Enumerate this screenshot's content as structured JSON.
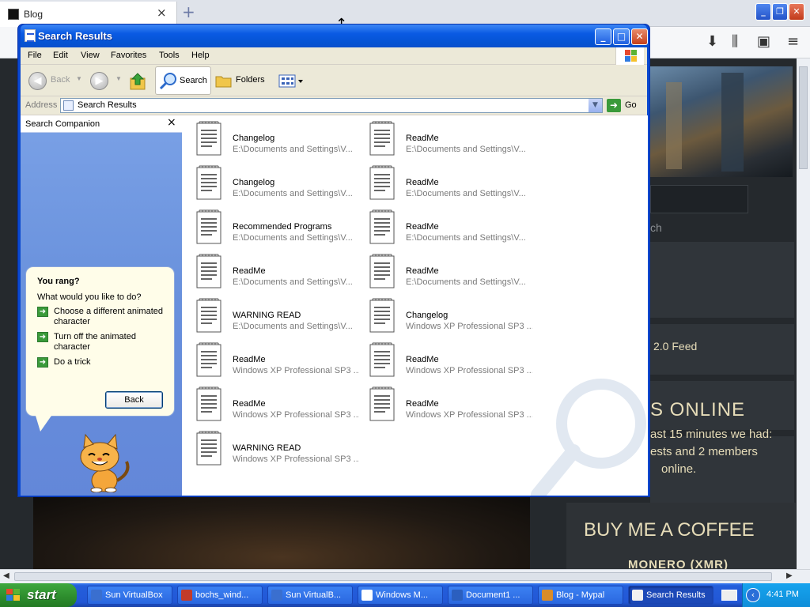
{
  "browser": {
    "tab_title": "Blog",
    "tab_close": "×",
    "new_tab": "+",
    "site": {
      "search_partial": "ch",
      "feed_text": "2.0 Feed",
      "online_title": "S ONLINE",
      "online_line1": "ast 15 minutes we had:",
      "online_line2": "ests and 2 members",
      "online_line3": "online.",
      "coffee_title": "BUY ME A COFFEE",
      "coffee_sub": "MONERO (XMR)"
    }
  },
  "window": {
    "title": "Search Results",
    "menu": [
      "File",
      "Edit",
      "View",
      "Favorites",
      "Tools",
      "Help"
    ],
    "toolbar": {
      "back_label": "Back",
      "search_label": "Search",
      "folders_label": "Folders"
    },
    "address": {
      "label": "Address",
      "value": "Search Results",
      "go_label": "Go"
    },
    "companion": {
      "title": "Search Companion",
      "close": "×",
      "question": "You rang?",
      "prompt": "What would you like to do?",
      "options": [
        "Choose a different animated character",
        "Turn off the animated character",
        "Do a trick"
      ],
      "back_button": "Back"
    },
    "results": [
      {
        "name": "Changelog",
        "path": "E:\\Documents and Settings\\V..."
      },
      {
        "name": "ReadMe",
        "path": "E:\\Documents and Settings\\V..."
      },
      {
        "name": "Changelog",
        "path": "E:\\Documents and Settings\\V..."
      },
      {
        "name": "ReadMe",
        "path": "E:\\Documents and Settings\\V..."
      },
      {
        "name": "Recommended Programs",
        "path": "E:\\Documents and Settings\\V..."
      },
      {
        "name": "ReadMe",
        "path": "E:\\Documents and Settings\\V..."
      },
      {
        "name": "ReadMe",
        "path": "E:\\Documents and Settings\\V..."
      },
      {
        "name": "ReadMe",
        "path": "E:\\Documents and Settings\\V..."
      },
      {
        "name": "WARNING READ",
        "path": "E:\\Documents and Settings\\V..."
      },
      {
        "name": "Changelog",
        "path": "Windows XP Professional SP3 ..."
      },
      {
        "name": "ReadMe",
        "path": "Windows XP Professional SP3 ..."
      },
      {
        "name": "ReadMe",
        "path": "Windows XP Professional SP3 ..."
      },
      {
        "name": "ReadMe",
        "path": "Windows XP Professional SP3 ..."
      },
      {
        "name": "ReadMe",
        "path": "Windows XP Professional SP3 ..."
      },
      {
        "name": "WARNING READ",
        "path": "Windows XP Professional SP3 ..."
      }
    ]
  },
  "taskbar": {
    "start_label": "start",
    "tasks": [
      {
        "label": "Sun VirtualBox",
        "icon_color": "#3a6fcf"
      },
      {
        "label": "bochs_wind...",
        "icon_color": "#c23b2a"
      },
      {
        "label": "Sun VirtualB...",
        "icon_color": "#3a6fcf"
      },
      {
        "label": "Windows M...",
        "icon_color": "#ffffff"
      },
      {
        "label": "Document1 ...",
        "icon_color": "#2b5fbf"
      },
      {
        "label": "Blog - Mypal",
        "icon_color": "#d98c2a"
      },
      {
        "label": "Search Results",
        "icon_color": "#f1f1f1"
      }
    ],
    "clock": "4:41 PM"
  }
}
